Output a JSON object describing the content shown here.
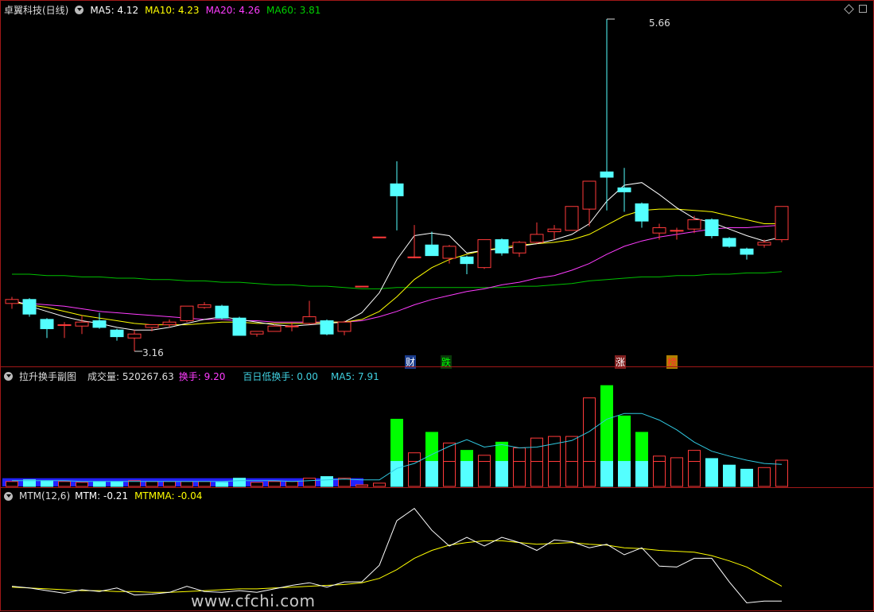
{
  "main": {
    "stock_label": "卓翼科技(日线)",
    "ma5": "MA5: 4.12",
    "ma10": "MA10: 4.23",
    "ma20": "MA20: 4.26",
    "ma60": "MA60: 3.81",
    "high_label": "5.66",
    "low_label": "3.16",
    "event_tags": [
      "财",
      "跌",
      "涨",
      "榜"
    ]
  },
  "sub1": {
    "title": "拉升换手副图",
    "volume": "成交量: 520267.63",
    "turnover": "换手: 9.20",
    "low100": "百日低换手: 0.00",
    "ma5": "MA5: 7.91"
  },
  "sub2": {
    "title": "MTM(12,6)",
    "mtm": "MTM: -0.21",
    "mtmma": "MTMMA: -0.04"
  },
  "watermark": "www.cfchi.com",
  "colors": {
    "up": "#ff3a3a",
    "down": "#54ffff",
    "ma5": "#ffffff",
    "ma10": "#ffff00",
    "ma20": "#ff3cff",
    "ma60": "#00c000",
    "vol_green": "#00ff00",
    "vol_blue": "#2222ff"
  },
  "chart_data": {
    "type": "candlestick",
    "candles": [
      {
        "o": 3.52,
        "c": 3.55,
        "h": 3.57,
        "l": 3.48
      },
      {
        "o": 3.55,
        "c": 3.44,
        "h": 3.56,
        "l": 3.42
      },
      {
        "o": 3.4,
        "c": 3.33,
        "h": 3.41,
        "l": 3.26
      },
      {
        "o": 3.36,
        "c": 3.36,
        "h": 3.38,
        "l": 3.26
      },
      {
        "o": 3.35,
        "c": 3.38,
        "h": 3.43,
        "l": 3.29
      },
      {
        "o": 3.39,
        "c": 3.34,
        "h": 3.45,
        "l": 3.33
      },
      {
        "o": 3.32,
        "c": 3.27,
        "h": 3.33,
        "l": 3.24
      },
      {
        "o": 3.26,
        "c": 3.29,
        "h": 3.32,
        "l": 3.16
      },
      {
        "o": 3.34,
        "c": 3.36,
        "h": 3.36,
        "l": 3.31
      },
      {
        "o": 3.36,
        "c": 3.38,
        "h": 3.4,
        "l": 3.34
      },
      {
        "o": 3.39,
        "c": 3.5,
        "h": 3.5,
        "l": 3.38
      },
      {
        "o": 3.49,
        "c": 3.51,
        "h": 3.53,
        "l": 3.48
      },
      {
        "o": 3.5,
        "c": 3.41,
        "h": 3.51,
        "l": 3.4
      },
      {
        "o": 3.41,
        "c": 3.28,
        "h": 3.42,
        "l": 3.28
      },
      {
        "o": 3.29,
        "c": 3.31,
        "h": 3.31,
        "l": 3.27
      },
      {
        "o": 3.31,
        "c": 3.35,
        "h": 3.36,
        "l": 3.31
      },
      {
        "o": 3.35,
        "c": 3.35,
        "h": 3.38,
        "l": 3.31
      },
      {
        "o": 3.37,
        "c": 3.42,
        "h": 3.54,
        "l": 3.36
      },
      {
        "o": 3.39,
        "c": 3.29,
        "h": 3.4,
        "l": 3.28
      },
      {
        "o": 3.31,
        "c": 3.38,
        "h": 3.39,
        "l": 3.28
      },
      {
        "o": 3.65,
        "c": 3.65,
        "h": 3.65,
        "l": 3.65
      },
      {
        "o": 4.02,
        "c": 4.02,
        "h": 4.02,
        "l": 4.02
      },
      {
        "o": 4.42,
        "c": 4.33,
        "h": 4.59,
        "l": 4.07
      },
      {
        "o": 3.87,
        "c": 3.87,
        "h": 4.11,
        "l": 3.86
      },
      {
        "o": 3.96,
        "c": 3.88,
        "h": 4.06,
        "l": 3.88
      },
      {
        "o": 3.86,
        "c": 3.95,
        "h": 3.96,
        "l": 3.82
      },
      {
        "o": 3.87,
        "c": 3.82,
        "h": 3.88,
        "l": 3.74
      },
      {
        "o": 3.79,
        "c": 4.0,
        "h": 4.0,
        "l": 3.78
      },
      {
        "o": 4.0,
        "c": 3.9,
        "h": 4.01,
        "l": 3.88
      },
      {
        "o": 3.9,
        "c": 3.98,
        "h": 3.99,
        "l": 3.87
      },
      {
        "o": 3.98,
        "c": 4.04,
        "h": 4.13,
        "l": 3.97
      },
      {
        "o": 4.06,
        "c": 4.08,
        "h": 4.11,
        "l": 4.0
      },
      {
        "o": 4.07,
        "c": 4.25,
        "h": 4.25,
        "l": 4.07
      },
      {
        "o": 4.23,
        "c": 4.44,
        "h": 4.44,
        "l": 4.1
      },
      {
        "o": 4.51,
        "c": 4.47,
        "h": 5.66,
        "l": 4.22
      },
      {
        "o": 4.39,
        "c": 4.36,
        "h": 4.54,
        "l": 4.21
      },
      {
        "o": 4.27,
        "c": 4.14,
        "h": 4.28,
        "l": 4.09
      },
      {
        "o": 4.05,
        "c": 4.09,
        "h": 4.12,
        "l": 4.0
      },
      {
        "o": 4.07,
        "c": 4.07,
        "h": 4.09,
        "l": 4.0
      },
      {
        "o": 4.08,
        "c": 4.15,
        "h": 4.18,
        "l": 4.05
      },
      {
        "o": 4.15,
        "c": 4.03,
        "h": 4.16,
        "l": 4.01
      },
      {
        "o": 4.01,
        "c": 3.95,
        "h": 4.02,
        "l": 3.94
      },
      {
        "o": 3.93,
        "c": 3.89,
        "h": 3.94,
        "l": 3.85
      },
      {
        "o": 3.96,
        "c": 3.98,
        "h": 4.0,
        "l": 3.94
      },
      {
        "o": 4.0,
        "c": 4.25,
        "h": 4.25,
        "l": 3.98
      }
    ],
    "ma5": [
      3.55,
      3.5,
      3.46,
      3.42,
      3.39,
      3.37,
      3.34,
      3.32,
      3.32,
      3.34,
      3.37,
      3.4,
      3.42,
      3.4,
      3.38,
      3.36,
      3.35,
      3.36,
      3.37,
      3.38,
      3.45,
      3.6,
      3.85,
      4.03,
      4.05,
      4.03,
      3.9,
      3.92,
      3.93,
      3.95,
      3.97,
      4.0,
      4.04,
      4.12,
      4.29,
      4.41,
      4.43,
      4.34,
      4.24,
      4.16,
      4.13,
      4.08,
      4.03,
      3.99,
      4.02
    ],
    "ma10": [
      3.53,
      3.51,
      3.49,
      3.46,
      3.43,
      3.41,
      3.39,
      3.37,
      3.36,
      3.36,
      3.36,
      3.37,
      3.38,
      3.38,
      3.37,
      3.37,
      3.37,
      3.37,
      3.38,
      3.38,
      3.4,
      3.46,
      3.57,
      3.7,
      3.79,
      3.85,
      3.89,
      3.92,
      3.94,
      3.96,
      3.97,
      3.98,
      4.0,
      4.04,
      4.11,
      4.18,
      4.22,
      4.23,
      4.23,
      4.22,
      4.21,
      4.18,
      4.15,
      4.12,
      4.12
    ],
    "ma20": [
      3.53,
      3.52,
      3.51,
      3.5,
      3.48,
      3.46,
      3.45,
      3.44,
      3.43,
      3.42,
      3.41,
      3.4,
      3.4,
      3.39,
      3.39,
      3.38,
      3.38,
      3.38,
      3.38,
      3.38,
      3.39,
      3.42,
      3.46,
      3.51,
      3.55,
      3.58,
      3.61,
      3.63,
      3.66,
      3.68,
      3.71,
      3.73,
      3.77,
      3.82,
      3.89,
      3.95,
      3.99,
      4.02,
      4.04,
      4.06,
      4.08,
      4.09,
      4.09,
      4.1,
      4.11
    ],
    "ma60": [
      3.74,
      3.74,
      3.73,
      3.73,
      3.72,
      3.72,
      3.71,
      3.71,
      3.7,
      3.7,
      3.69,
      3.69,
      3.68,
      3.68,
      3.67,
      3.66,
      3.66,
      3.65,
      3.65,
      3.64,
      3.63,
      3.63,
      3.64,
      3.64,
      3.64,
      3.64,
      3.64,
      3.64,
      3.64,
      3.65,
      3.65,
      3.66,
      3.67,
      3.69,
      3.7,
      3.71,
      3.72,
      3.72,
      3.73,
      3.73,
      3.74,
      3.74,
      3.75,
      3.75,
      3.76
    ],
    "turnover": [
      0.6,
      0.8,
      0.7,
      0.6,
      0.5,
      0.6,
      0.6,
      0.7,
      0.6,
      0.6,
      0.6,
      0.6,
      0.5,
      1.0,
      0.5,
      0.6,
      0.6,
      1.0,
      1.2,
      1.0,
      0.2,
      0.4,
      8.2,
      4.1,
      6.6,
      5.3,
      4.4,
      3.8,
      5.4,
      4.7,
      5.9,
      6.1,
      6.1,
      10.8,
      12.3,
      8.6,
      6.6,
      3.7,
      3.5,
      4.4,
      3.4,
      2.6,
      2.1,
      2.3,
      3.2
    ],
    "turnover_ma5": [
      0.7,
      0.7,
      0.7,
      0.7,
      0.6,
      0.6,
      0.6,
      0.6,
      0.6,
      0.6,
      0.6,
      0.6,
      0.6,
      0.7,
      0.7,
      0.7,
      0.6,
      0.7,
      0.8,
      0.9,
      0.8,
      0.8,
      2.2,
      2.8,
      3.9,
      4.9,
      5.7,
      4.8,
      5.1,
      4.7,
      4.8,
      5.2,
      5.6,
      6.7,
      8.2,
      8.9,
      8.9,
      8.1,
      6.9,
      5.4,
      4.3,
      3.7,
      3.2,
      2.8,
      2.7
    ],
    "mtm": [
      -0.04,
      -0.06,
      -0.09,
      -0.12,
      -0.08,
      -0.1,
      -0.06,
      -0.14,
      -0.13,
      -0.11,
      -0.04,
      -0.1,
      -0.11,
      -0.09,
      -0.11,
      -0.07,
      -0.03,
      0.0,
      -0.05,
      0.01,
      0.01,
      0.2,
      0.71,
      0.85,
      0.6,
      0.42,
      0.52,
      0.42,
      0.52,
      0.46,
      0.37,
      0.49,
      0.47,
      0.4,
      0.44,
      0.32,
      0.4,
      0.19,
      0.18,
      0.28,
      0.28,
      0.01,
      -0.23,
      -0.21,
      -0.21
    ],
    "mtmma": [
      -0.05,
      -0.06,
      -0.07,
      -0.08,
      -0.09,
      -0.09,
      -0.1,
      -0.1,
      -0.11,
      -0.11,
      -0.1,
      -0.09,
      -0.08,
      -0.07,
      -0.07,
      -0.06,
      -0.05,
      -0.04,
      -0.03,
      -0.02,
      0.0,
      0.05,
      0.15,
      0.28,
      0.37,
      0.43,
      0.46,
      0.48,
      0.48,
      0.46,
      0.44,
      0.45,
      0.46,
      0.44,
      0.43,
      0.4,
      0.39,
      0.37,
      0.36,
      0.35,
      0.31,
      0.25,
      0.18,
      0.07,
      -0.04
    ]
  }
}
